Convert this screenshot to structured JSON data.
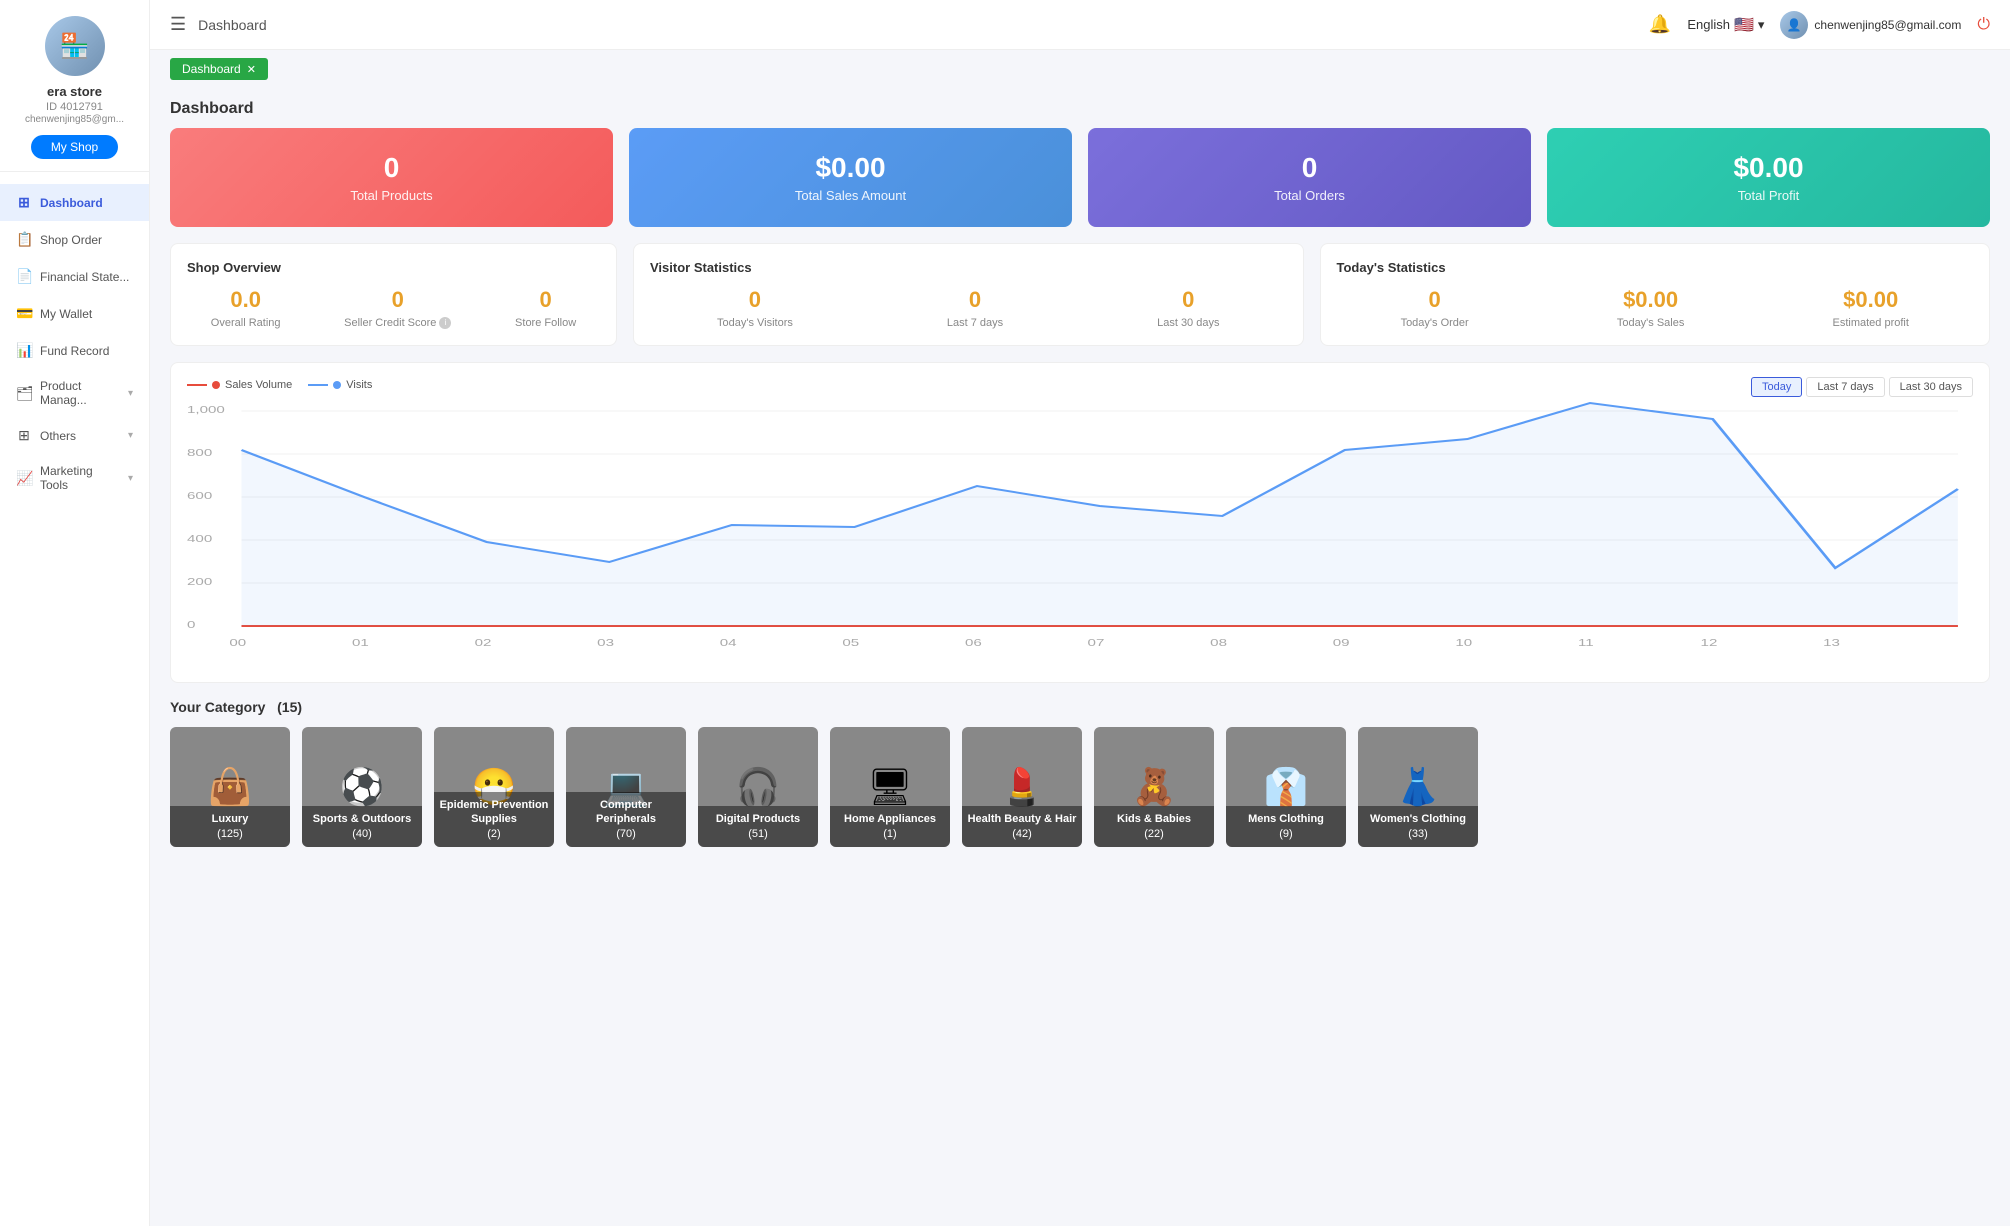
{
  "sidebar": {
    "store_name": "era store",
    "store_id": "ID 4012791",
    "store_email": "chenwenjing85@gm...",
    "avatar_icon": "🏪",
    "my_shop_label": "My Shop",
    "items": [
      {
        "id": "dashboard",
        "label": "Dashboard",
        "icon": "⊞",
        "active": true,
        "has_chevron": false
      },
      {
        "id": "shop-order",
        "label": "Shop Order",
        "icon": "📋",
        "active": false,
        "has_chevron": false
      },
      {
        "id": "financial-state",
        "label": "Financial State...",
        "icon": "📄",
        "active": false,
        "has_chevron": false
      },
      {
        "id": "my-wallet",
        "label": "My Wallet",
        "icon": "💳",
        "active": false,
        "has_chevron": false
      },
      {
        "id": "fund-record",
        "label": "Fund Record",
        "icon": "📊",
        "active": false,
        "has_chevron": false
      },
      {
        "id": "product-manage",
        "label": "Product Manag...",
        "icon": "🗂",
        "active": false,
        "has_chevron": true
      },
      {
        "id": "others",
        "label": "Others",
        "icon": "⊞",
        "active": false,
        "has_chevron": true
      },
      {
        "id": "marketing-tools",
        "label": "Marketing Tools",
        "icon": "📈",
        "active": false,
        "has_chevron": true
      }
    ]
  },
  "topbar": {
    "title": "Dashboard",
    "language": "English",
    "user_email": "chenwenjing85@gmail.com"
  },
  "breadcrumb": {
    "label": "Dashboard",
    "active": true
  },
  "dashboard": {
    "title": "Dashboard",
    "stat_cards": [
      {
        "id": "total-products",
        "value": "0",
        "label": "Total Products",
        "color": "pink"
      },
      {
        "id": "total-sales",
        "value": "$0.00",
        "label": "Total Sales Amount",
        "color": "blue"
      },
      {
        "id": "total-orders",
        "value": "0",
        "label": "Total Orders",
        "color": "purple"
      },
      {
        "id": "total-profit",
        "value": "$0.00",
        "label": "Total Profit",
        "color": "teal"
      }
    ],
    "shop_overview": {
      "title": "Shop Overview",
      "overall_rating": "0.0",
      "overall_rating_label": "Overall Rating",
      "seller_credit": "0",
      "seller_credit_label": "Seller Credit Score",
      "store_follow": "0",
      "store_follow_label": "Store Follow"
    },
    "visitor_stats": {
      "title": "Visitor Statistics",
      "today_visitors": "0",
      "today_visitors_label": "Today's Visitors",
      "last_7_days": "0",
      "last_7_days_label": "Last 7 days",
      "last_30_days": "0",
      "last_30_days_label": "Last 30 days"
    },
    "today_stats": {
      "title": "Today's Statistics",
      "today_order": "0",
      "today_order_label": "Today's Order",
      "today_sales": "$0.00",
      "today_sales_label": "Today's Sales",
      "estimated_profit": "$0.00",
      "estimated_profit_label": "Estimated profit"
    },
    "chart": {
      "legend_sales": "Sales Volume",
      "legend_visits": "Visits",
      "btn_today": "Today",
      "btn_7days": "Last 7 days",
      "btn_30days": "Last 30 days",
      "y_labels": [
        "1,000",
        "800",
        "600",
        "400",
        "200",
        "0"
      ],
      "x_labels": [
        "00",
        "01",
        "02",
        "03",
        "04",
        "05",
        "06",
        "07",
        "08",
        "09",
        "10",
        "11",
        "12",
        "13"
      ],
      "visits_data": [
        820,
        600,
        390,
        300,
        470,
        460,
        650,
        560,
        510,
        820,
        870,
        1060,
        960,
        270,
        630
      ]
    },
    "categories": {
      "title": "Your Category",
      "count": 15,
      "items": [
        {
          "id": "luxury",
          "name": "Luxury",
          "count": 125,
          "color_class": "cat-luxury",
          "emoji": "👜"
        },
        {
          "id": "sports",
          "name": "Sports & Outdoors",
          "count": 40,
          "color_class": "cat-sports",
          "emoji": "⚽"
        },
        {
          "id": "epidemic",
          "name": "Epidemic Prevention Supplies",
          "count": 2,
          "color_class": "cat-epidemic",
          "emoji": "😷"
        },
        {
          "id": "computer",
          "name": "Computer Peripherals",
          "count": 70,
          "color_class": "cat-computer",
          "emoji": "💻"
        },
        {
          "id": "digital",
          "name": "Digital Products",
          "count": 51,
          "color_class": "cat-digital",
          "emoji": "🎧"
        },
        {
          "id": "appliances",
          "name": "Home Appliances",
          "count": 1,
          "color_class": "cat-appliances",
          "emoji": "🖥"
        },
        {
          "id": "health",
          "name": "Health Beauty & Hair",
          "count": 42,
          "color_class": "cat-health",
          "emoji": "💄"
        },
        {
          "id": "kids",
          "name": "Kids & Babies",
          "count": 22,
          "color_class": "cat-kids",
          "emoji": "🧸"
        },
        {
          "id": "mens",
          "name": "Mens Clothing",
          "count": 9,
          "color_class": "cat-mens",
          "emoji": "👔"
        },
        {
          "id": "womens",
          "name": "Women's Clothing",
          "count": 33,
          "color_class": "cat-womens",
          "emoji": "👗"
        }
      ]
    }
  }
}
